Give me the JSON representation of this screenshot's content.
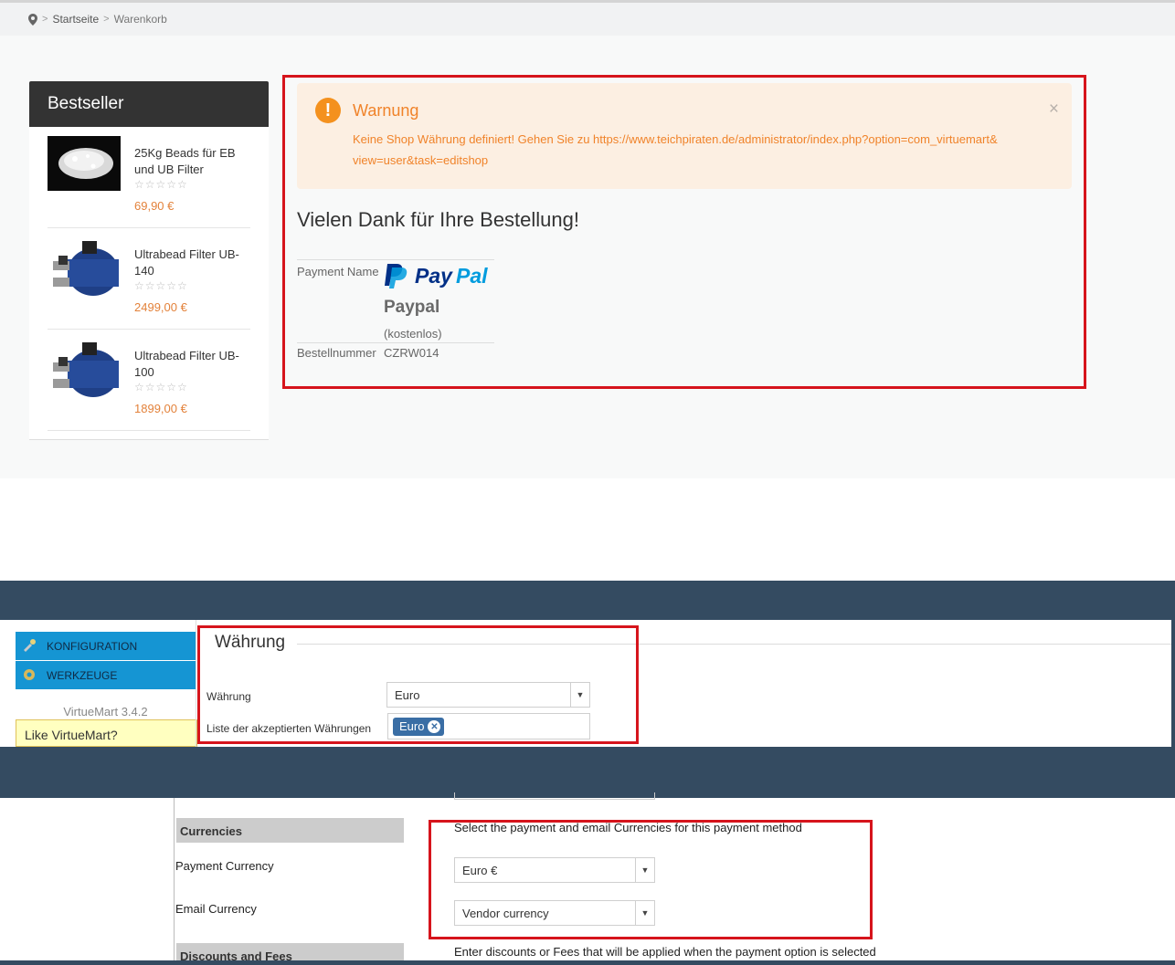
{
  "breadcrumb": {
    "items": [
      "Startseite",
      "Warenkorb"
    ]
  },
  "bestseller": {
    "title": "Bestseller",
    "items": [
      {
        "name": "25Kg Beads für EB und UB Filter",
        "price": "69,90 €",
        "stars": "☆☆☆☆☆"
      },
      {
        "name": "Ultrabead Filter UB-140",
        "price": "2499,00 €",
        "stars": "☆☆☆☆☆"
      },
      {
        "name": "Ultrabead Filter UB-100",
        "price": "1899,00 €",
        "stars": "☆☆☆☆☆"
      }
    ]
  },
  "warning": {
    "title": "Warnung",
    "text": "Keine Shop Währung definiert! Gehen Sie zu https://www.teichpiraten.de/administrator/index.php?option=com_virtuemart& view=user&task=editshop",
    "close": "×"
  },
  "order": {
    "thanks": "Vielen Dank für Ihre Bestellung!",
    "payment_label": "Payment Name",
    "payment_name": "Paypal",
    "payment_cost": "(kostenlos)",
    "number_label": "Bestellnummer",
    "number_value": "CZRW014",
    "logo_text_a": "Pay",
    "logo_text_b": "Pal"
  },
  "vm_sidebar": {
    "menu": [
      "KONFIGURATION",
      "WERKZEUGE"
    ],
    "version": "VirtueMart 3.4.2",
    "like": "Like VirtueMart?"
  },
  "currency_settings": {
    "legend": "Währung",
    "currency_label": "Währung",
    "currency_value": "Euro",
    "accepted_label": "Liste der akzeptierten Währungen",
    "accepted_chip": "Euro"
  },
  "payment_method": {
    "currencies_head": "Currencies",
    "currencies_hint": "Select the payment and email Currencies for this payment method",
    "payment_currency_label": "Payment Currency",
    "payment_currency_value": "Euro €",
    "email_currency_label": "Email Currency",
    "email_currency_value": "Vendor currency",
    "discounts_head": "Discounts and Fees",
    "discounts_hint": "Enter discounts or Fees that will be applied when the payment option is selected"
  },
  "colors": {
    "highlight_border": "#d6141c",
    "warning_bg": "#fcefe2",
    "warning_text": "#f0832a",
    "price": "#e3823b",
    "admin_bar": "#344b61",
    "vm_menu": "#1595d3",
    "chip": "#3a6ea5"
  }
}
